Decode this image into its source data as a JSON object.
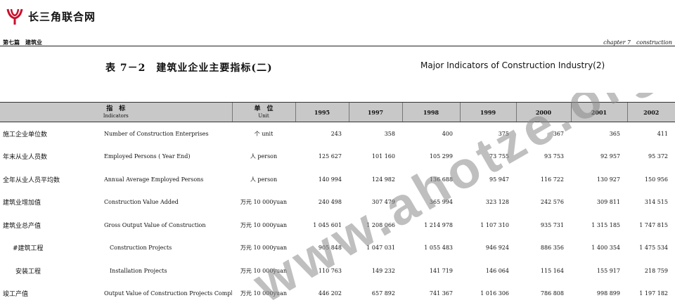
{
  "site": {
    "logo_text": "长三角联合网"
  },
  "header": {
    "left": "第七篇　建筑业",
    "right": "chapter 7　construction"
  },
  "title": {
    "zh": "表 7－2　建筑业企业主要指标(二)",
    "en": "Major Indicators of Construction Industry(2)"
  },
  "table": {
    "indicator_header": {
      "zh": "指　标",
      "en": "Indicators"
    },
    "unit_header": {
      "zh": "单　位",
      "en": "Unit"
    },
    "years": [
      "1995",
      "1997",
      "1998",
      "1999",
      "2000",
      "2001",
      "2002"
    ],
    "rows": [
      {
        "zh": "施工企业单位数",
        "en": "Number of Construction Enterprises",
        "unit": "个 unit",
        "values": [
          "243",
          "358",
          "400",
          "375",
          "367",
          "365",
          "411"
        ]
      },
      {
        "zh": "年末从业人员数",
        "en": "Employed Persons ( Year End)",
        "unit": "人 person",
        "values": [
          "125 627",
          "101 160",
          "105 299",
          "73 755",
          "93 753",
          "92 957",
          "95 372"
        ]
      },
      {
        "zh": "全年从业人员平均数",
        "en": "Annual Average Employed Persons",
        "unit": "人 person",
        "values": [
          "140 994",
          "124 982",
          "136 688",
          "95 947",
          "116 722",
          "130 927",
          "150 956"
        ]
      },
      {
        "zh": "建筑业增加值",
        "en": "Construction Value Added",
        "unit": "万元 10 000yuan",
        "values": [
          "240 498",
          "307 479",
          "365 994",
          "323 128",
          "242 576",
          "309 811",
          "314 515"
        ]
      },
      {
        "zh": "建筑业总产值",
        "en": "Gross Output Value of Construction",
        "unit": "万元 10 000yuan",
        "values": [
          "1 045 601",
          "1 208 066",
          "1 214 978",
          "1 107 310",
          "935 731",
          "1 315 185",
          "1 747 815"
        ]
      },
      {
        "zh": "#建筑工程",
        "en": "Construction Projects",
        "unit": "万元 10 000yuan",
        "values": [
          "905 848",
          "1 047 031",
          "1 055 483",
          "946 924",
          "886 356",
          "1 400 354",
          "1 475 534"
        ]
      },
      {
        "zh": "安装工程",
        "en": "Installation Projects",
        "unit": "万元 10 000yuan",
        "values": [
          "110 763",
          "149 232",
          "141 719",
          "146 064",
          "115 164",
          "155 917",
          "218 759"
        ]
      },
      {
        "zh": "竣工产值",
        "en": "Output Value of Construction Projects Completed",
        "unit": "万元 10 000yuan",
        "values": [
          "446 202",
          "657 892",
          "741 367",
          "1 016 306",
          "786 808",
          "998 899",
          "1 197 182"
        ]
      }
    ]
  },
  "watermark": {
    "text": "www.ahotze.org.cn",
    "color": "#8a8a8a"
  }
}
